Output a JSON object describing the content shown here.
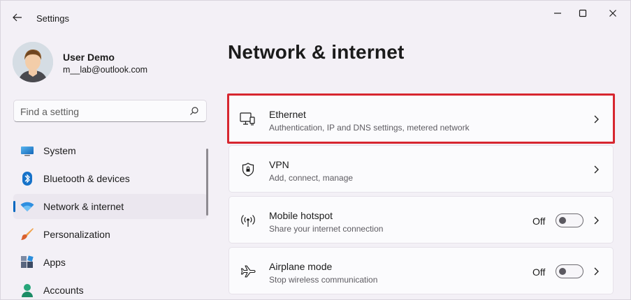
{
  "titlebar": {
    "title": "Settings"
  },
  "user": {
    "name": "User Demo",
    "email": "m__lab@outlook.com"
  },
  "search": {
    "placeholder": "Find a setting"
  },
  "sidebar": {
    "items": [
      {
        "label": "System",
        "icon": "monitor-icon"
      },
      {
        "label": "Bluetooth & devices",
        "icon": "bluetooth-icon"
      },
      {
        "label": "Network & internet",
        "icon": "wifi-icon",
        "active": true
      },
      {
        "label": "Personalization",
        "icon": "brush-icon"
      },
      {
        "label": "Apps",
        "icon": "apps-icon"
      },
      {
        "label": "Accounts",
        "icon": "person-icon"
      }
    ]
  },
  "main": {
    "title": "Network & internet",
    "cards": [
      {
        "title": "Ethernet",
        "desc": "Authentication, IP and DNS settings, metered network",
        "icon": "ethernet-icon",
        "highlighted": true
      },
      {
        "title": "VPN",
        "desc": "Add, connect, manage",
        "icon": "shield-icon"
      },
      {
        "title": "Mobile hotspot",
        "desc": "Share your internet connection",
        "icon": "hotspot-icon",
        "toggle": "Off"
      },
      {
        "title": "Airplane mode",
        "desc": "Stop wireless communication",
        "icon": "airplane-icon",
        "toggle": "Off"
      }
    ]
  },
  "colors": {
    "accent": "#0067c0",
    "highlight_border": "#d7262f"
  }
}
